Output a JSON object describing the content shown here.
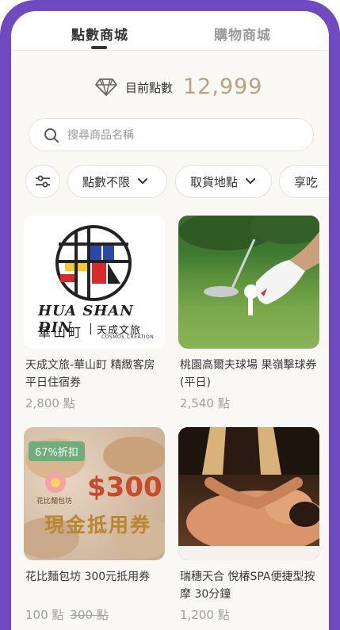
{
  "tabs": [
    {
      "label": "點數商城",
      "active": true
    },
    {
      "label": "購物商城",
      "active": false
    }
  ],
  "points": {
    "label": "目前點數",
    "value": "12,999"
  },
  "search": {
    "placeholder": "搜尋商品名稱"
  },
  "filters": {
    "settings_icon": "sliders-icon",
    "points_label": "點數不限",
    "pickup_label": "取貨地點",
    "more_label": "享吃"
  },
  "products": [
    {
      "title": "天成文旅-華山町 精緻客房平日住宿券",
      "price": "2,800 點",
      "image_text": {
        "brand_line1": "HUA SHAN DIN",
        "brand_line2": "華山町",
        "brand_line3": "天成文旅",
        "brand_line4": "COSMOS CREATION"
      }
    },
    {
      "title": "桃園高爾夫球場 果嶺擊球券(平日)",
      "price": "2,540 點"
    },
    {
      "title": "花比麵包坊 300元抵用券",
      "price": "100 點",
      "price_old": "300 點",
      "badge": "67%折扣",
      "image_text": {
        "shop": "花比麵包坊",
        "amount": "$300",
        "caption": "現金抵用券"
      }
    },
    {
      "title": "瑞穗天合 悅椿SPA便捷型按摩 30分鐘",
      "price": "1,200 點"
    }
  ],
  "colors": {
    "frame": "#6e4bc0",
    "points_value": "#b8a27e",
    "badge": "#6fae7c"
  }
}
